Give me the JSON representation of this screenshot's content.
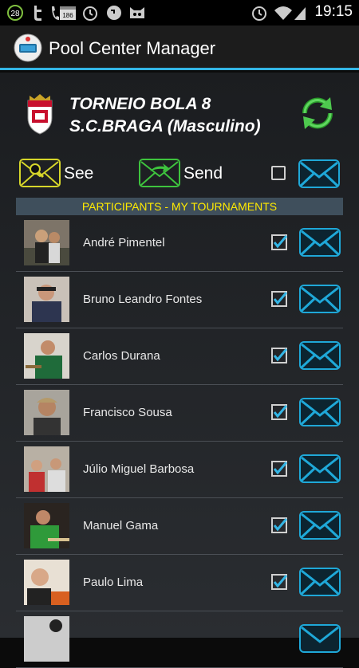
{
  "status_bar": {
    "notification_count": "28",
    "badge_number": "186",
    "time": "19:15"
  },
  "app": {
    "title": "Pool Center Manager"
  },
  "tournament": {
    "name_line1": "TORNEIO BOLA 8",
    "name_line2": "S.C.BRAGA (Masculino)"
  },
  "actions": {
    "see_label": "See",
    "send_label": "Send"
  },
  "section_header": "PARTICIPANTS - MY TOURNAMENTS",
  "participants": [
    {
      "name": "André Pimentel",
      "checked": true
    },
    {
      "name": "Bruno Leandro Fontes",
      "checked": true
    },
    {
      "name": "Carlos Durana",
      "checked": true
    },
    {
      "name": "Francisco Sousa",
      "checked": true
    },
    {
      "name": "Júlio Miguel Barbosa",
      "checked": true
    },
    {
      "name": "Manuel Gama",
      "checked": true
    },
    {
      "name": "Paulo Lima",
      "checked": true
    }
  ],
  "colors": {
    "accent": "#33b5e5",
    "checkbox": "#33b5e5",
    "header_text": "#ffea00",
    "header_bg": "#3f4f5c",
    "refresh": "#3ec43e"
  }
}
